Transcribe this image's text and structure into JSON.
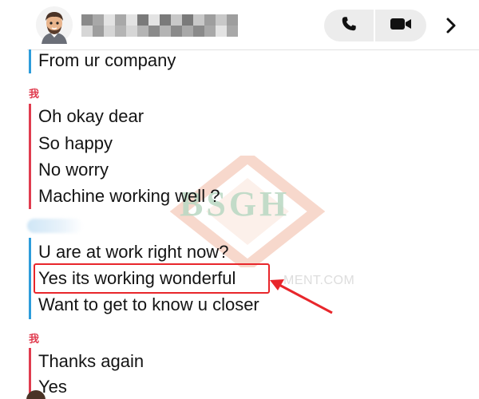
{
  "header": {
    "contact_avatar_icon": "bitmoji-avatar-icon",
    "call_icon": "phone-icon",
    "video_icon": "video-camera-icon",
    "more_icon": "chevron-right-icon"
  },
  "messages": [
    {
      "sender": "contact",
      "text": "From ur company"
    },
    {
      "sender": "我",
      "lines": [
        "Oh okay dear",
        "So happy",
        "No worry",
        "Machine working well ?"
      ]
    },
    {
      "sender": "contact",
      "lines": [
        "U are at work right now?",
        "Yes its working wonderful",
        "Want to get to know u closer"
      ]
    },
    {
      "sender": "我",
      "lines": [
        "Thanks again",
        "Yes"
      ]
    }
  ],
  "watermark": {
    "logo_text": "BSGH",
    "domain_text": "MENT.COM"
  },
  "colors": {
    "contact_bar": "#2d9cdb",
    "self_bar": "#e03c4f",
    "highlight": "#e8262b",
    "header_button_bg": "#ececec"
  }
}
